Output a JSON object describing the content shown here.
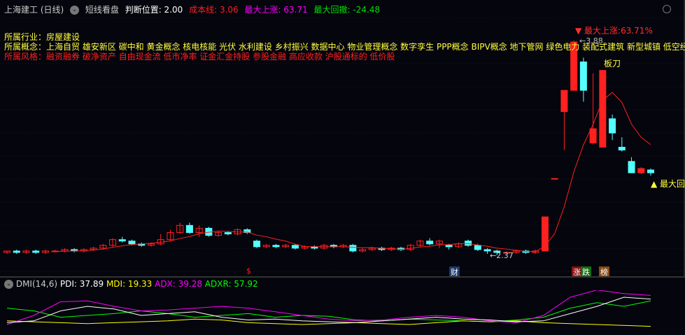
{
  "header": {
    "title": "上海建工 (日线)",
    "mode": "短线看盘",
    "judge": "判断位置: 2.00",
    "cost": "成本线: 3.06",
    "max_up": "最大上涨: 63.71",
    "max_dd": "最大回撤: -24.48"
  },
  "info": {
    "industry": "所属行业：房屋建设",
    "concepts": "所属概念：上海自贸 雄安新区 碳中和 黄金概念 核电核能 光伏 水利建设 乡村振兴 数据中心 物业管理概念 数字孪生 PPP概念 BIPV概念 地下管网 绿色电力 装配式建筑 新型城镇 低空经济",
    "styles": "所属风格：融资融券 破净资产 自由现金流 低市净率 证金汇金持股 参股金融 高应收款 沪股通标的 低价股"
  },
  "annotations": {
    "max_up_label": "▼ 最大上涨:63.71%",
    "blade": "板刀",
    "max_dd_label": "▲ 最大回",
    "low": "←2.37",
    "high": "←3.88"
  },
  "tags": {
    "s": "$",
    "cai": "财",
    "zhang": "涨",
    "die": "跌",
    "bang": "榜"
  },
  "dmi": {
    "title": "DMI(14,6)",
    "pdi": "PDI: 37.89",
    "mdi": "MDI: 19.33",
    "adx": "ADX: 39.28",
    "adxr": "ADXR: 57.92"
  },
  "colors": {
    "up": "#ff2020",
    "down": "#54ffff",
    "ma": "#ff2020",
    "pdi": "#ffffff",
    "mdi": "#ffff00",
    "adx": "#ff00ff",
    "adxr": "#00ff00"
  },
  "chart_data": {
    "type": "candlestick",
    "price_range": [
      2.37,
      3.88
    ],
    "candles": [
      [
        2.39,
        2.4,
        2.4,
        2.38
      ],
      [
        2.4,
        2.39,
        2.41,
        2.38
      ],
      [
        2.39,
        2.4,
        2.41,
        2.38
      ],
      [
        2.4,
        2.39,
        2.41,
        2.38
      ],
      [
        2.39,
        2.4,
        2.41,
        2.38
      ],
      [
        2.4,
        2.4,
        2.41,
        2.39
      ],
      [
        2.4,
        2.41,
        2.42,
        2.39
      ],
      [
        2.41,
        2.4,
        2.42,
        2.39
      ],
      [
        2.4,
        2.41,
        2.42,
        2.39
      ],
      [
        2.41,
        2.42,
        2.43,
        2.4
      ],
      [
        2.42,
        2.44,
        2.45,
        2.41
      ],
      [
        2.44,
        2.48,
        2.49,
        2.43
      ],
      [
        2.48,
        2.47,
        2.5,
        2.46
      ],
      [
        2.47,
        2.45,
        2.48,
        2.44
      ],
      [
        2.45,
        2.44,
        2.46,
        2.43
      ],
      [
        2.44,
        2.45,
        2.46,
        2.43
      ],
      [
        2.45,
        2.48,
        2.52,
        2.44
      ],
      [
        2.48,
        2.53,
        2.55,
        2.47
      ],
      [
        2.53,
        2.58,
        2.6,
        2.52
      ],
      [
        2.58,
        2.53,
        2.6,
        2.52
      ],
      [
        2.53,
        2.56,
        2.58,
        2.5
      ],
      [
        2.56,
        2.51,
        2.57,
        2.5
      ],
      [
        2.51,
        2.53,
        2.54,
        2.5
      ],
      [
        2.53,
        2.52,
        2.54,
        2.51
      ],
      [
        2.52,
        2.55,
        2.56,
        2.51
      ],
      [
        2.55,
        2.53,
        2.56,
        2.52
      ],
      [
        2.47,
        2.43,
        2.48,
        2.42
      ],
      [
        2.43,
        2.44,
        2.45,
        2.42
      ],
      [
        2.44,
        2.43,
        2.45,
        2.42
      ],
      [
        2.43,
        2.44,
        2.45,
        2.42
      ],
      [
        2.44,
        2.42,
        2.45,
        2.41
      ],
      [
        2.42,
        2.43,
        2.44,
        2.41
      ],
      [
        2.43,
        2.42,
        2.44,
        2.41
      ],
      [
        2.42,
        2.44,
        2.45,
        2.41
      ],
      [
        2.44,
        2.43,
        2.45,
        2.42
      ],
      [
        2.43,
        2.44,
        2.45,
        2.42
      ],
      [
        2.44,
        2.4,
        2.45,
        2.39
      ],
      [
        2.4,
        2.41,
        2.42,
        2.39
      ],
      [
        2.41,
        2.42,
        2.43,
        2.4
      ],
      [
        2.42,
        2.41,
        2.43,
        2.4
      ],
      [
        2.41,
        2.42,
        2.43,
        2.4
      ],
      [
        2.42,
        2.41,
        2.43,
        2.4
      ],
      [
        2.41,
        2.44,
        2.45,
        2.4
      ],
      [
        2.44,
        2.47,
        2.48,
        2.43
      ],
      [
        2.47,
        2.45,
        2.49,
        2.44
      ],
      [
        2.45,
        2.47,
        2.48,
        2.42
      ],
      [
        2.44,
        2.43,
        2.45,
        2.41
      ],
      [
        2.43,
        2.45,
        2.46,
        2.42
      ],
      [
        2.47,
        2.44,
        2.48,
        2.43
      ],
      [
        2.44,
        2.41,
        2.45,
        2.4
      ],
      [
        2.41,
        2.4,
        2.42,
        2.38
      ],
      [
        2.4,
        2.39,
        2.41,
        2.37
      ],
      [
        2.39,
        2.39,
        2.4,
        2.38
      ],
      [
        2.39,
        2.4,
        2.41,
        2.38
      ],
      [
        2.4,
        2.39,
        2.41,
        2.38
      ],
      [
        2.39,
        2.4,
        2.41,
        2.38
      ],
      [
        2.4,
        2.64,
        2.64,
        2.4
      ],
      [
        2.91,
        2.91,
        2.91,
        2.91
      ],
      [
        3.38,
        3.53,
        3.53,
        3.11
      ],
      [
        3.53,
        3.87,
        3.88,
        3.53
      ],
      [
        3.73,
        3.53,
        3.76,
        3.45
      ],
      [
        3.16,
        3.26,
        3.65,
        3.15
      ],
      [
        3.13,
        3.67,
        3.67,
        3.13
      ],
      [
        3.33,
        3.23,
        3.36,
        3.18
      ],
      [
        3.13,
        3.11,
        3.2,
        3.1
      ],
      [
        3.03,
        2.95,
        3.06,
        2.95
      ],
      [
        2.95,
        2.98,
        2.99,
        2.94
      ],
      [
        2.97,
        2.95,
        2.98,
        2.93
      ]
    ],
    "ma_period": 6,
    "dmi": {
      "pdi": [
        12,
        14,
        25,
        30,
        27,
        20,
        22,
        24,
        18,
        15,
        16,
        14,
        13,
        12,
        14,
        16,
        18,
        16,
        15,
        13,
        14,
        22,
        30,
        40,
        38
      ],
      "mdi": [
        14,
        13,
        12,
        11,
        12,
        13,
        14,
        16,
        15,
        12,
        11,
        10,
        11,
        12,
        11,
        10,
        12,
        14,
        13,
        14,
        12,
        11,
        10,
        9,
        8
      ],
      "adx": [
        10,
        20,
        35,
        36,
        30,
        25,
        26,
        28,
        30,
        28,
        24,
        20,
        16,
        14,
        15,
        18,
        20,
        18,
        14,
        12,
        20,
        40,
        48,
        44,
        42
      ],
      "adxr": [
        28,
        25,
        18,
        20,
        22,
        25,
        22,
        18,
        20,
        22,
        18,
        20,
        19,
        15,
        14,
        16,
        15,
        14,
        13,
        15,
        18,
        28,
        34,
        30,
        36
      ]
    }
  }
}
